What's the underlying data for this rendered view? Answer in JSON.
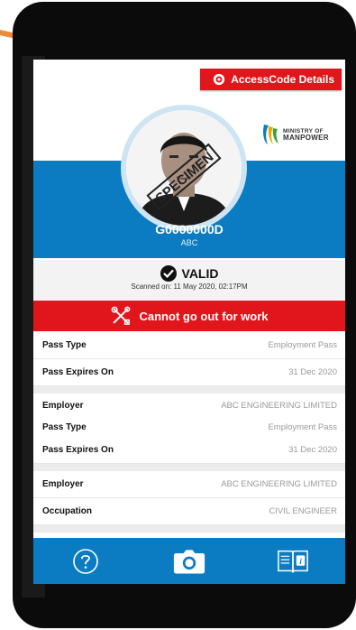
{
  "access_code_button": {
    "label": "AccessCode Details",
    "icon": "gear-circle-icon"
  },
  "ministry": {
    "line1": "MINISTRY OF",
    "line2": "MANPOWER"
  },
  "profile": {
    "id_number": "G0000000D",
    "name": "ABC",
    "photo_watermark": "SPECIMEN"
  },
  "status": {
    "label": "VALID",
    "scanned": "Scanned on: 11 May 2020, 02:17PM"
  },
  "alert": {
    "label": "Cannot go out for work",
    "icon": "tools-crossed-icon"
  },
  "details": {
    "group1": [
      {
        "key": "Pass Type",
        "value": "Employment Pass"
      },
      {
        "key": "Pass Expires On",
        "value": "31 Dec 2020"
      }
    ],
    "group2": [
      {
        "key": "Employer",
        "value": "ABC ENGINEERING LIMITED"
      },
      {
        "key": "Pass Type",
        "value": "Employment Pass"
      },
      {
        "key": "Pass Expires On",
        "value": "31 Dec 2020"
      }
    ],
    "group3": [
      {
        "key": "Employer",
        "value": "ABC ENGINEERING LIMITED"
      },
      {
        "key": "Occupation",
        "value": "CIVIL ENGINEER"
      }
    ]
  },
  "nav": {
    "help": "help-icon",
    "camera": "camera-icon",
    "guide": "guide-book-icon"
  },
  "colors": {
    "primary_blue": "#0b7cc1",
    "alert_red": "#e1161c",
    "arrow_orange": "#ee8a3b"
  }
}
